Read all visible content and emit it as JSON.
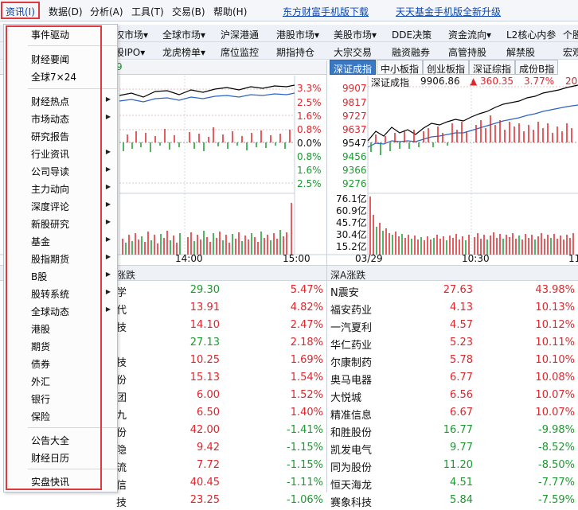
{
  "topmenu": {
    "items": [
      "资讯(I)",
      "数据(D)",
      "分析(A)",
      "工具(T)",
      "交易(B)",
      "帮助(H)"
    ],
    "links": [
      "东方财富手机版下载",
      "天天基金手机版全新升级"
    ]
  },
  "tabs_row1": [
    "权市场▾",
    "全球市场▾",
    "沪深港通",
    "港股市场▾",
    "美股市场▾",
    "DDE决策",
    "资金流向▾",
    "L2核心内参",
    "个股"
  ],
  "tabs_row2": [
    "股IPO▾",
    "龙虎榜单▾",
    "席位监控",
    "期指持仓",
    "大宗交易",
    "融资融券",
    "高管持股",
    "解禁股",
    "宏观"
  ],
  "left_chart": {
    "right_labels": [
      "3.3%",
      "2.5%",
      "1.6%",
      "0.8%",
      "0.0%",
      "0.8%",
      "1.6%",
      "2.5%"
    ],
    "top_value": "9",
    "time_labels": [
      "14:00",
      "15:00"
    ]
  },
  "index_tabs": [
    "深证成指",
    "中小板指",
    "创业板指",
    "深证综指",
    "成份B指"
  ],
  "right_chart": {
    "title": "深证成指",
    "value": "9906.86",
    "change": "▲ 360.35",
    "pct": "3.77%",
    "extra": "20",
    "price_labels": [
      "9907",
      "9817",
      "9727",
      "9637",
      "9547",
      "9456",
      "9366",
      "9276"
    ],
    "vol_labels": [
      "76.1亿",
      "60.9亿",
      "45.7亿",
      "30.4亿",
      "15.2亿"
    ],
    "time_labels": [
      "03/29",
      "10:30",
      "11"
    ]
  },
  "left_list": {
    "header": "涨跌",
    "rows": [
      {
        "name": "学",
        "price": "29.30",
        "pct": "5.47%"
      },
      {
        "name": "代",
        "price": "13.91",
        "pct": "4.82%"
      },
      {
        "name": "技",
        "price": "14.10",
        "pct": "2.47%"
      },
      {
        "name": "",
        "price": "27.13",
        "pct": "2.18%"
      },
      {
        "name": "技",
        "price": "10.25",
        "pct": "1.69%"
      },
      {
        "name": "份",
        "price": "15.13",
        "pct": "1.54%"
      },
      {
        "name": "团",
        "price": "6.00",
        "pct": "1.52%"
      },
      {
        "name": "九",
        "price": "6.50",
        "pct": "1.40%"
      },
      {
        "name": "份",
        "price": "42.00",
        "pct": "-1.41%"
      },
      {
        "name": "隐",
        "price": "9.42",
        "pct": "-1.15%"
      },
      {
        "name": "流",
        "price": "7.72",
        "pct": "-1.15%"
      },
      {
        "name": "信",
        "price": "40.45",
        "pct": "-1.11%"
      },
      {
        "name": "技",
        "price": "23.25",
        "pct": "-1.06%"
      }
    ]
  },
  "right_list": {
    "header": "深A涨跌",
    "rows": [
      {
        "name": "N震安",
        "price": "27.63",
        "pct": "43.98%"
      },
      {
        "name": "福安药业",
        "price": "4.13",
        "pct": "10.13%"
      },
      {
        "name": "一汽夏利",
        "price": "4.57",
        "pct": "10.12%"
      },
      {
        "name": "华仁药业",
        "price": "5.23",
        "pct": "10.11%"
      },
      {
        "name": "尔康制药",
        "price": "5.78",
        "pct": "10.10%"
      },
      {
        "name": "奥马电器",
        "price": "6.77",
        "pct": "10.08%"
      },
      {
        "name": "大悦城",
        "price": "6.56",
        "pct": "10.07%"
      },
      {
        "name": "精准信息",
        "price": "6.67",
        "pct": "10.07%"
      },
      {
        "name": "和胜股份",
        "price": "16.77",
        "pct": "-9.98%"
      },
      {
        "name": "凯发电气",
        "price": "9.77",
        "pct": "-8.52%"
      },
      {
        "name": "同为股份",
        "price": "11.20",
        "pct": "-8.50%"
      },
      {
        "name": "恒天海龙",
        "price": "4.51",
        "pct": "-7.77%"
      },
      {
        "name": "赛象科技",
        "price": "5.84",
        "pct": "-7.59%"
      }
    ]
  },
  "dropdown": {
    "items": [
      {
        "label": "事件驱动",
        "sub": false
      },
      {
        "label": "财经要闻",
        "sub": false
      },
      {
        "label": "全球7×24",
        "sub": false
      },
      {
        "label": "财经热点",
        "sub": true
      },
      {
        "label": "市场动态",
        "sub": true
      },
      {
        "label": "研究报告",
        "sub": false
      },
      {
        "label": "行业资讯",
        "sub": true
      },
      {
        "label": "公司导读",
        "sub": true
      },
      {
        "label": "主力动向",
        "sub": true
      },
      {
        "label": "深度评论",
        "sub": true
      },
      {
        "label": "新股研究",
        "sub": true
      },
      {
        "label": "基金",
        "sub": true
      },
      {
        "label": "股指期货",
        "sub": true
      },
      {
        "label": "B股",
        "sub": true
      },
      {
        "label": "股转系统",
        "sub": true
      },
      {
        "label": "全球动态",
        "sub": true
      },
      {
        "label": "港股",
        "sub": false
      },
      {
        "label": "期货",
        "sub": false
      },
      {
        "label": "债券",
        "sub": false
      },
      {
        "label": "外汇",
        "sub": false
      },
      {
        "label": "银行",
        "sub": false
      },
      {
        "label": "保险",
        "sub": false
      },
      {
        "label": "公告大全",
        "sub": false
      },
      {
        "label": "财经日历",
        "sub": false
      },
      {
        "label": "实盘快讯",
        "sub": false
      }
    ]
  }
}
